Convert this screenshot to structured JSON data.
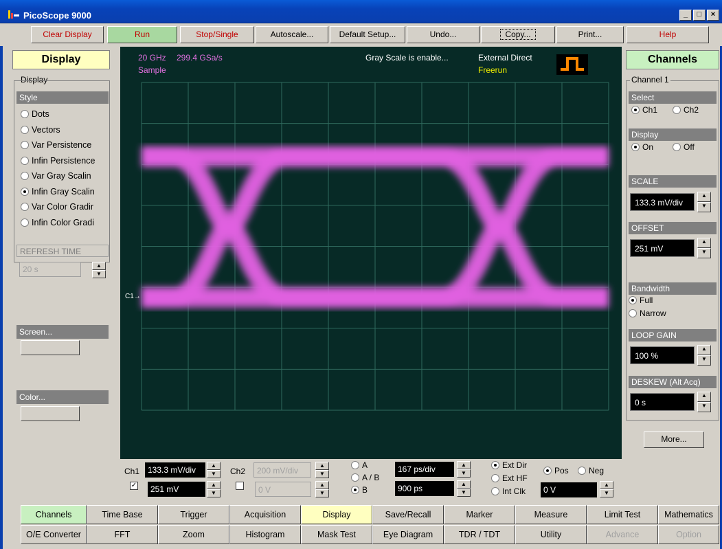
{
  "window": {
    "title": "PicoScope 9000",
    "controls": [
      "minimize",
      "maximize",
      "close"
    ]
  },
  "toolbar": {
    "buttons": [
      "Clear Display",
      "Run",
      "Stop/Single",
      "Autoscale...",
      "Default Setup...",
      "Undo...",
      "Copy...",
      "Print...",
      "Help"
    ]
  },
  "left_panel": {
    "header": "Display",
    "group_label": "Display",
    "style_header": "Style",
    "style_options": [
      {
        "label": "Dots",
        "selected": false
      },
      {
        "label": "Vectors",
        "selected": false
      },
      {
        "label": "Var Persistence",
        "selected": false
      },
      {
        "label": "Infin Persistence",
        "selected": false
      },
      {
        "label": "Var Gray Scalin",
        "selected": false
      },
      {
        "label": "Infin Gray Scalin",
        "selected": true
      },
      {
        "label": "Var Color Gradir",
        "selected": false
      },
      {
        "label": "Infin Color Gradi",
        "selected": false
      }
    ],
    "refresh_header": "REFRESH TIME",
    "refresh_value": "20 s",
    "screen_header": "Screen...",
    "color_header": "Color..."
  },
  "scope": {
    "bandwidth": "20 GHz",
    "sample_rate": "299.4 GSa/s",
    "mode": "Sample",
    "status": "Gray Scale  is enable...",
    "trigger_source": "External Direct",
    "trigger_mode": "Freerun",
    "channel_marker": "C1",
    "trace_color": "#e060e0"
  },
  "right_panel": {
    "header": "Channels",
    "group_label": "Channel 1",
    "select_header": "Select",
    "select_options": [
      {
        "label": "Ch1",
        "selected": true
      },
      {
        "label": "Ch2",
        "selected": false
      }
    ],
    "display_header": "Display",
    "display_options": [
      {
        "label": "On",
        "selected": true
      },
      {
        "label": "Off",
        "selected": false
      }
    ],
    "scale_header": "SCALE",
    "scale_value": "133.3 mV/div",
    "offset_header": "OFFSET",
    "offset_value": "251 mV",
    "bandwidth_header": "Bandwidth",
    "bandwidth_options": [
      {
        "label": "Full",
        "selected": true
      },
      {
        "label": "Narrow",
        "selected": false
      }
    ],
    "loop_gain_header": "LOOP GAIN",
    "loop_gain_value": "100 %",
    "deskew_header": "DESKEW (Alt Acq)",
    "deskew_value": "0 s",
    "more_button": "More..."
  },
  "bottom_controls": {
    "ch1_label": "Ch1",
    "ch1_scale": "133.3 mV/div",
    "ch1_offset": "251 mV",
    "ch2_label": "Ch2",
    "ch2_scale": "200 mV/div",
    "ch2_offset": "0 V",
    "timebase_options": [
      {
        "label": "A",
        "selected": false
      },
      {
        "label": "A / B",
        "selected": false
      },
      {
        "label": "B",
        "selected": true
      }
    ],
    "time_per_div": "167 ps/div",
    "delay": "900 ps",
    "trigger_options": [
      {
        "label": "Ext Dir",
        "selected": true
      },
      {
        "label": "Ext HF",
        "selected": false
      },
      {
        "label": "Int Clk",
        "selected": false
      }
    ],
    "slope_options": [
      {
        "label": "Pos",
        "selected": true
      },
      {
        "label": "Neg",
        "selected": false
      }
    ],
    "trigger_level": "0 V"
  },
  "tabs": {
    "row1": [
      "Channels",
      "Time Base",
      "Trigger",
      "Acquisition",
      "Display",
      "Save/Recall",
      "Marker",
      "Measure",
      "Limit Test",
      "Mathematics"
    ],
    "row2": [
      "O/E Converter",
      "FFT",
      "Zoom",
      "Histogram",
      "Mask Test",
      "Eye Diagram",
      "TDR / TDT",
      "Utility",
      "Advance",
      "Option"
    ]
  }
}
